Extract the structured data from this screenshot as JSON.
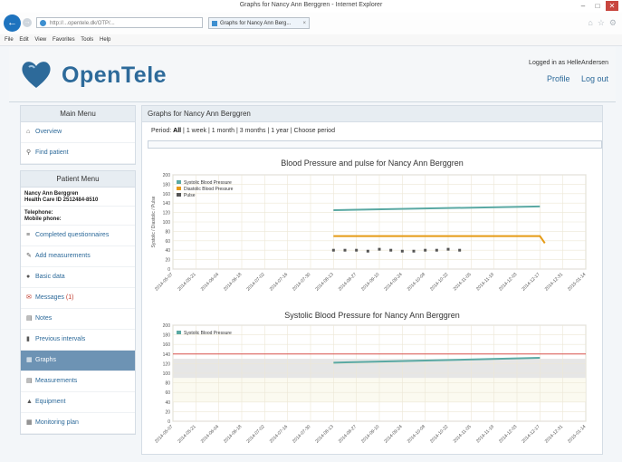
{
  "browser": {
    "window_title": "Graphs for Nancy Ann Berggren - Internet Explorer",
    "address": "http://...opentele.dk/OTP/...",
    "tab_title": "Graphs for Nancy Ann Berg...",
    "menu": [
      "File",
      "Edit",
      "View",
      "Favorites",
      "Tools",
      "Help"
    ]
  },
  "header": {
    "app_name": "OpenTele",
    "logged_in_as": "Logged in as HelleAndersen",
    "profile": "Profile",
    "logout": "Log out"
  },
  "main_menu": {
    "title": "Main Menu",
    "items": [
      {
        "icon": "home-icon",
        "label": "Overview"
      },
      {
        "icon": "search-icon",
        "label": "Find patient"
      }
    ]
  },
  "patient_menu": {
    "title": "Patient Menu",
    "patient_name": "Nancy Ann Berggren",
    "health_id": "Health Care ID 2512484-8510",
    "phone_label": "Telephone:",
    "mobile_label": "Mobile phone:",
    "items": [
      {
        "icon": "list-icon",
        "label": "Completed questionnaires"
      },
      {
        "icon": "edit-icon",
        "label": "Add measurements"
      },
      {
        "icon": "user-icon",
        "label": "Basic data"
      },
      {
        "icon": "mail-icon",
        "label": "Messages",
        "badge": "(1)"
      },
      {
        "icon": "notes-icon",
        "label": "Notes"
      },
      {
        "icon": "book-icon",
        "label": "Previous intervals"
      },
      {
        "icon": "graph-icon",
        "label": "Graphs",
        "active": true
      },
      {
        "icon": "table-icon",
        "label": "Measurements"
      },
      {
        "icon": "equipment-icon",
        "label": "Equipment"
      },
      {
        "icon": "calendar-icon",
        "label": "Monitoring plan"
      }
    ]
  },
  "main": {
    "title": "Graphs for Nancy Ann Berggren",
    "period_label": "Period:",
    "period_options": [
      "All",
      "1 week",
      "1 month",
      "3 months",
      "1 year",
      "Choose period"
    ],
    "selected_period": "All"
  },
  "chart_data": [
    {
      "type": "line",
      "title": "Blood Pressure and pulse for Nancy Ann Berggren",
      "ylabel": "Systolic / Diastolic / Pulse",
      "ylim": [
        0,
        200
      ],
      "y_ticks": [
        0,
        20,
        40,
        60,
        80,
        100,
        120,
        140,
        160,
        180,
        200
      ],
      "x_ticks": [
        "2014-05-07",
        "2014-05-21",
        "2014-06-04",
        "2014-06-18",
        "2014-07-02",
        "2014-07-16",
        "2014-07-30",
        "2014-08-13",
        "2014-08-27",
        "2014-09-10",
        "2014-09-24",
        "2014-10-08",
        "2014-10-22",
        "2014-11-05",
        "2014-11-19",
        "2014-12-03",
        "2014-12-17",
        "2014-12-31",
        "2015-01-14"
      ],
      "legend": [
        "Systolic Blood Pressure",
        "Diastolic Blood Pressure",
        "Pulse"
      ],
      "legend_placement": "top-left",
      "colors": [
        "#5aa9a3",
        "#e59a14",
        "#555555"
      ],
      "series": [
        {
          "name": "Systolic Blood Pressure",
          "x": [
            "2014-08-13",
            "2014-12-17"
          ],
          "values": [
            125,
            133
          ]
        },
        {
          "name": "Diastolic Blood Pressure",
          "x": [
            "2014-08-13",
            "2014-12-17",
            "2014-12-20"
          ],
          "values": [
            70,
            70,
            55
          ]
        },
        {
          "name": "Pulse",
          "x": [
            "2014-08-13",
            "2014-08-20",
            "2014-08-27",
            "2014-09-03",
            "2014-09-10",
            "2014-09-17",
            "2014-09-24",
            "2014-10-01",
            "2014-10-08",
            "2014-10-15",
            "2014-10-22",
            "2014-10-29"
          ],
          "values": [
            40,
            40,
            40,
            38,
            42,
            40,
            38,
            38,
            40,
            40,
            42,
            40
          ]
        }
      ]
    },
    {
      "type": "line",
      "title": "Systolic Blood Pressure for Nancy Ann Berggren",
      "ylim": [
        0,
        200
      ],
      "y_ticks": [
        0,
        20,
        40,
        60,
        80,
        100,
        120,
        140,
        160,
        180,
        200
      ],
      "x_ticks": [
        "2014-05-07",
        "2014-05-21",
        "2014-06-04",
        "2014-06-18",
        "2014-07-02",
        "2014-07-16",
        "2014-07-30",
        "2014-08-13",
        "2014-08-27",
        "2014-09-10",
        "2014-09-24",
        "2014-10-08",
        "2014-10-22",
        "2014-11-05",
        "2014-11-19",
        "2014-12-03",
        "2014-12-17",
        "2014-12-31",
        "2015-01-14"
      ],
      "legend": [
        "Systolic Blood Pressure"
      ],
      "legend_placement": "top-left",
      "colors": [
        "#5aa9a3"
      ],
      "threshold_high": 140,
      "normal_band": [
        90,
        130
      ],
      "series": [
        {
          "name": "Systolic Blood Pressure",
          "x": [
            "2014-08-13",
            "2014-12-17"
          ],
          "values": [
            122,
            132
          ]
        }
      ]
    }
  ]
}
